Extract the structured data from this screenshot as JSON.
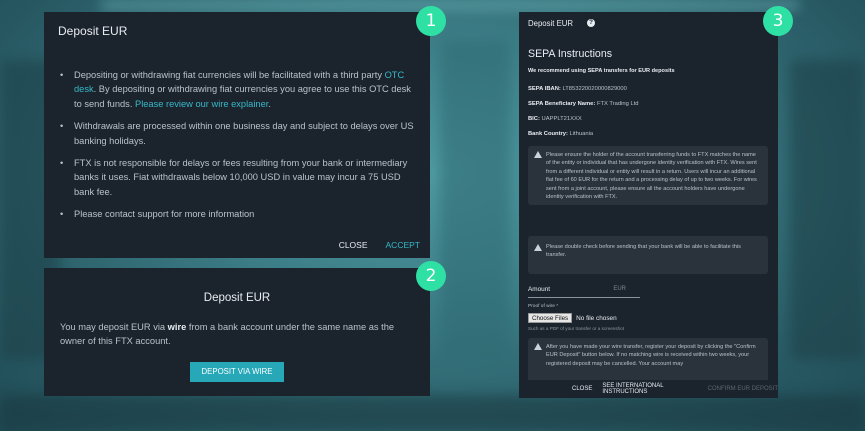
{
  "badges": [
    "1",
    "2",
    "3"
  ],
  "panel1": {
    "title": "Deposit EUR",
    "bullet1_a": "Depositing or withdrawing fiat currencies will be facilitated with a third party ",
    "bullet1_link1": "OTC desk",
    "bullet1_b": ". By depositing or withdrawing fiat currencies you agree to use this OTC desk to send funds. ",
    "bullet1_link2": "Please review our wire explainer",
    "bullet1_c": ".",
    "bullet2": "Withdrawals are processed within one business day and subject to delays over US banking holidays.",
    "bullet3": "FTX is not responsible for delays or fees resulting from your bank or intermediary banks it uses. Fiat withdrawals below 10,000 USD in value may incur a 75 USD bank fee.",
    "bullet4": "Please contact support for more information",
    "close_label": "CLOSE",
    "accept_label": "ACCEPT"
  },
  "panel2": {
    "title": "Deposit EUR",
    "text_a": "You may deposit EUR via ",
    "text_bold": "wire",
    "text_b": " from a bank account under the same name as the owner of this FTX account.",
    "button_label": "DEPOSIT VIA WIRE"
  },
  "panel3": {
    "header": "Deposit EUR",
    "help": "?",
    "heading": "SEPA Instructions",
    "recommend": "We recommend using SEPA transfers for EUR deposits",
    "iban_label": "SEPA IBAN:",
    "iban_value": " LT853220020000829000",
    "beneficiary_label": "SEPA Beneficiary Name:",
    "beneficiary_value": " FTX Trading Ltd",
    "bic_label": "BIC:",
    "bic_value": " UAPPLT21XXX",
    "country_label": "Bank Country:",
    "country_value": " Lithuania",
    "warning1": "Please ensure the holder of the account transferring funds to FTX matches the name of the entity or individual that has undergone identity verification with FTX. Wires sent from a different individual or entity will result in a return. Users will incur an additional flat fee of 60 EUR for the return and a processing delay of up to two weeks. For wires sent from a joint account, please ensure all the account holders have undergone identity verification with FTX.",
    "warning2": "Please double check before sending that your bank will be able to facilitate this transfer.",
    "amount_label": "Amount",
    "amount_currency": "EUR",
    "proof_label": "Proof of wire *",
    "file_button": "Choose Files",
    "file_status": "No file chosen",
    "file_hint": "Such as a PDF of your transfer or a screenshot",
    "warning3": "After you have made your wire transfer, register your deposit by clicking the \"Confirm EUR Deposit\" button below. If no matching wire is received within two weeks, your registered deposit may be cancelled. Your account may",
    "close_label": "CLOSE",
    "intl_label": "SEE INTERNATIONAL INSTRUCTIONS",
    "confirm_label": "CONFIRM EUR DEPOSIT"
  }
}
